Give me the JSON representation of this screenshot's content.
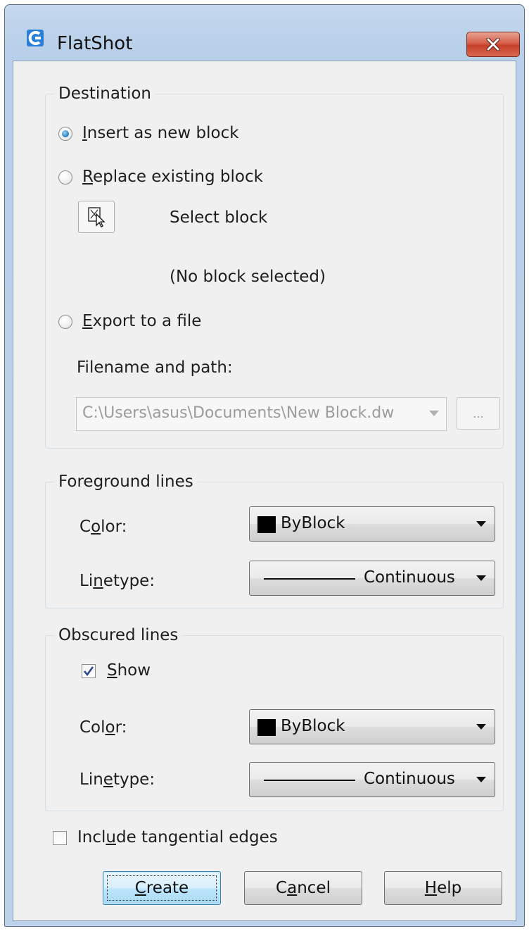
{
  "window": {
    "title": "FlatShot",
    "app_icon": "app-icon",
    "close_icon": "close-icon",
    "close_color": "#c6402a"
  },
  "destination": {
    "legend": "Destination",
    "insert_new_block": {
      "pre": "",
      "key": "I",
      "post": "nsert as new block",
      "selected": true
    },
    "replace_existing_block": {
      "pre": "",
      "key": "R",
      "post": "eplace existing block",
      "selected": false
    },
    "select_block_icon": "select-block-icon",
    "select_block_label": "Select block",
    "block_status": "(No block selected)",
    "export_to_file": {
      "pre": "",
      "key": "E",
      "post": "xport to a file",
      "selected": false
    },
    "filename_label": "Filename and path:",
    "filename_value": "C:\\Users\\asus\\Documents\\New Block.dw",
    "browse_label": "..."
  },
  "foreground": {
    "legend": "Foreground lines",
    "color_label": {
      "pre": "C",
      "key": "o",
      "post": "lor:"
    },
    "color_value": "ByBlock",
    "color_swatch": "#000000",
    "linetype_label": {
      "pre": "Li",
      "key": "n",
      "post": "etype:"
    },
    "linetype_value": "Continuous"
  },
  "obscured": {
    "legend": "Obscured lines",
    "show": {
      "pre": "",
      "key": "S",
      "post": "how",
      "checked": true
    },
    "color_label": {
      "pre": "Col",
      "key": "o",
      "post": "r:"
    },
    "color_value": "ByBlock",
    "color_swatch": "#000000",
    "linetype_label": {
      "pre": "Lin",
      "key": "e",
      "post": "type:"
    },
    "linetype_value": "Continuous"
  },
  "tangential": {
    "pre": "Incl",
    "key": "u",
    "post": "de tangential edges",
    "checked": false
  },
  "buttons": {
    "create": {
      "pre": "",
      "key": "C",
      "post": "reate"
    },
    "cancel": {
      "pre": "C",
      "key": "a",
      "post": "ncel"
    },
    "help": {
      "pre": "",
      "key": "H",
      "post": "elp"
    }
  },
  "colors": {
    "frame": "#bcd2eb",
    "client": "#f0f0f0",
    "accent": "#2f86c8",
    "default_button": "#bee6fd"
  }
}
